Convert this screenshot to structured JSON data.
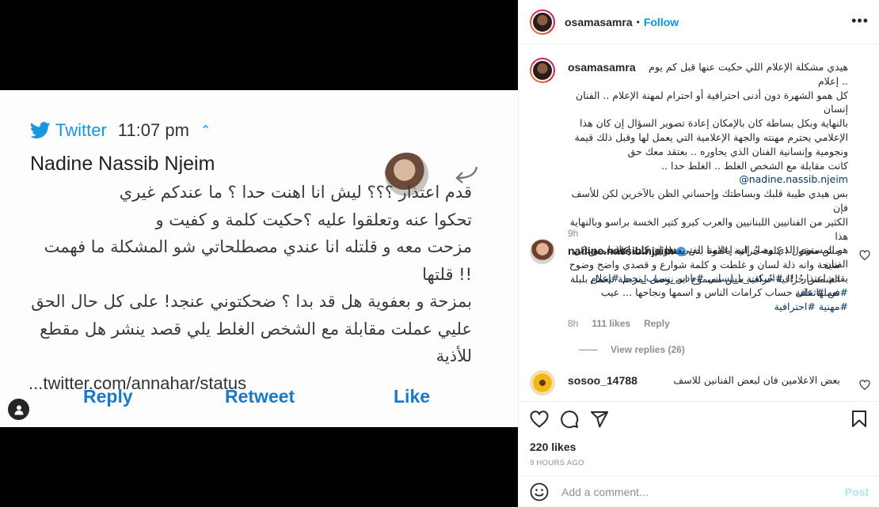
{
  "colors": {
    "accent": "#0095f6",
    "twitter_blue": "#1b95e0",
    "muted": "#8e8e8e",
    "text": "#262626",
    "hashtag": "#00376b"
  },
  "media": {
    "tweet": {
      "service": "Twitter",
      "time": "11:07 pm",
      "author": "Nadine Nassib Njeim",
      "lines": [
        "قدم اعتذار ؟؟؟ ليش انا اهنت حدا ؟ ما عندكم غيري",
        "تحكوا عنه وتعلقوا عليه ؟حكيت كلمة و كفيت و",
        "مزحت معه و قلتله انا عندي مصطلحاتي شو المشكلة ما فهمت !! قلتها",
        "بمزحة و بعفوية هل قد بدا ؟ ضحكتوني عنجد! على كل حال الحق",
        "عليي عملت مقابلة مع الشخص الغلط يلي قصد ينشر هل مقطع للأذية"
      ],
      "link": "...twitter.com/annahar/status",
      "actions": {
        "reply": "Reply",
        "retweet": "Retweet",
        "like": "Like"
      }
    }
  },
  "header": {
    "username": "osamasamra",
    "separator": "•",
    "follow": "Follow",
    "more": "•••"
  },
  "caption": {
    "username": "osamasamra",
    "text_lines": [
      "هيدي مشكلة الإعلام اللي حكيت عنها قبل كم يوم .. إعلام",
      "كل همو الشهرة دون أدنى احترافية أو احترام لمهنة الإعلام .. الفنان إنسان",
      "بالنهاية وبكل بساطة كان بالإمكان إعادة تصوير السؤال إن كان هذا",
      "الإعلامي يحترم مهنته والجهة الإعلامية التي يعمل لها وقبل ذلك قيمة",
      "ونجومية وإنسانية الفنان الذي يحاوره .. بعتقد معك حق",
      "كانت مقابلة مع الشخص الغلط .. الغلط حدا .. "
    ],
    "mention": "@nadine.nassib.njeim",
    "text_lines_2": [
      "بس هيدي طيبة قلبك وبساطتك وإحساني الظن بالآخرين لكن للأسف فإن",
      "الكثير من الفنانيين اللبنانيين والعرب كبرو كتير الخسة براسو وبالنهاية هذا",
      "هو المستوى الذي وصل إليه إعلامنا الفني هذا إن كان إعلاما.. وبدكن الفنان",
      "يقدم اعتذار !!! "
    ],
    "hashtags_line_1": "#اسكت_يا_لساني #نادين_نسيب_نجيم #إعلام #فن #ثقافة",
    "hashtags_line_2": "#مهنية #احترافية",
    "time": "9h"
  },
  "comments": [
    {
      "username": "nadine.nassib.njeim",
      "verified": "✓",
      "text": "مش معقول ! كلمة حُراتية بالقوة بدن يعملوني قلت كلمة مش منيحة وانه ذلة لسان و غلطت و كلمة شوارع و قصدي واضح وضوح الشمس حُراقية حُراقية مش مسموح انه نوصل لمرحلة تنعمل بلبلة نعملها على حساب كرامات الناس و اسمها ونجاحها ... عيب",
      "time": "8h",
      "likes": "111 likes",
      "reply": "Reply",
      "view_replies": "View replies (26)"
    },
    {
      "username": "sosoo_14788",
      "text": "بعض الاعلامين فان لبعض الفنانين للاسف"
    }
  ],
  "actions": {
    "likes": "220 likes",
    "time_ago": "9 hours ago"
  },
  "add_comment": {
    "placeholder": "Add a comment...",
    "post": "Post"
  }
}
